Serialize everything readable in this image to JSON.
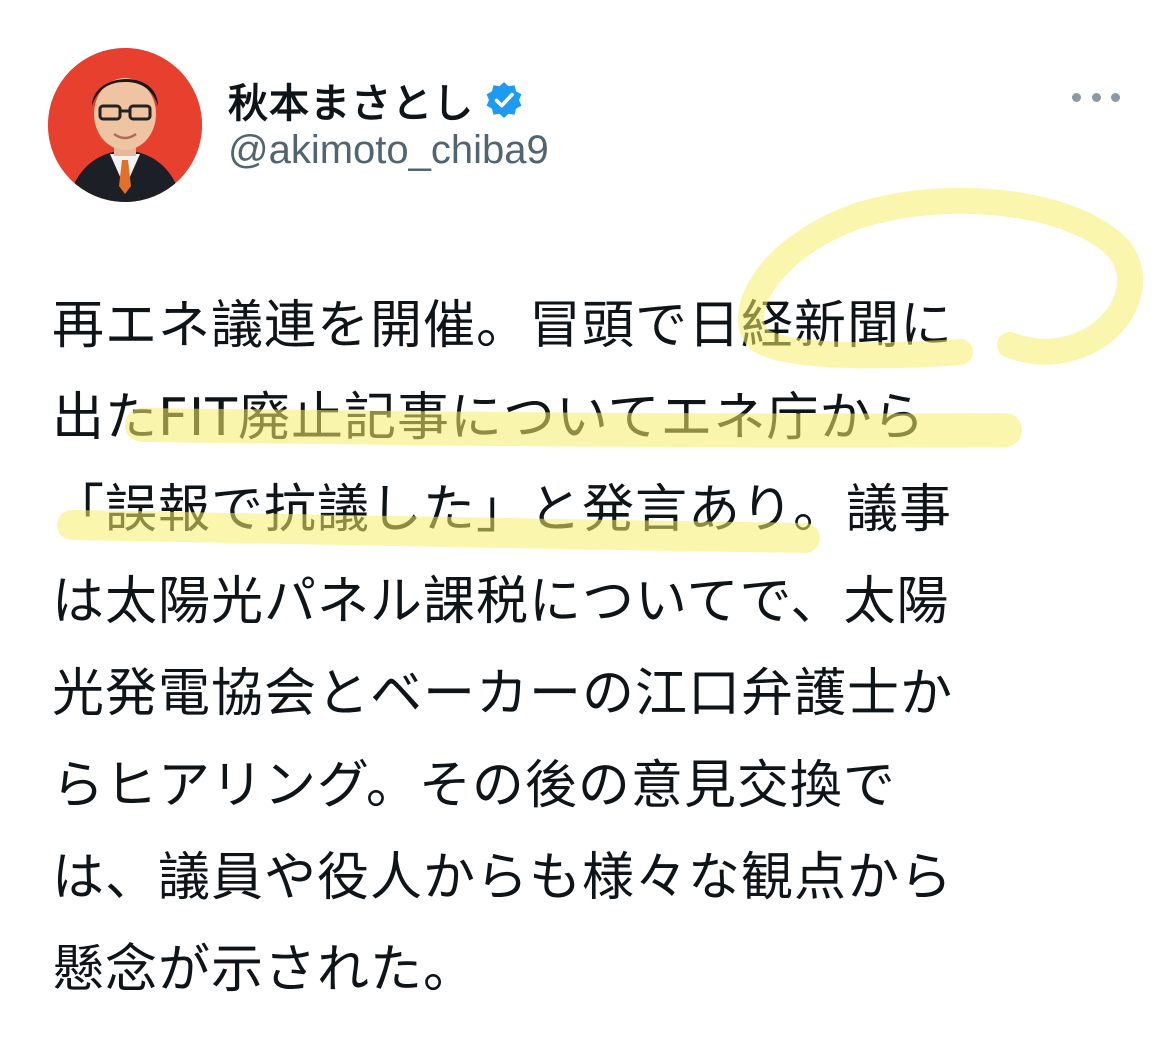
{
  "tweet": {
    "author": {
      "display_name": "秋本まさとし",
      "handle": "@akimoto_chiba9",
      "verified": true,
      "avatar_icon": "profile-photo",
      "avatar_background": "#e8402f"
    },
    "more_icon": "more-horizontal-icon",
    "body_lines": [
      "再エネ議連を開催。冒頭で日経新聞に",
      "出たFIT廃止記事についてエネ庁から",
      "「誤報で抗議した」と発言あり。議事",
      "は太陽光パネル課税についてで、太陽",
      "光発電協会とベーカーの江口弁護士か",
      "らヒアリング。その後の意見交換で",
      "は、議員や役人からも様々な観点から",
      "懸念が示された。"
    ],
    "highlight_color": "#f6ee6a"
  }
}
